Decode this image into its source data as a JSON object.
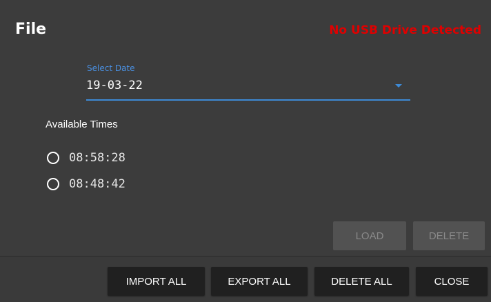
{
  "dialog": {
    "title": "File",
    "usb_status": "No USB Drive Detected",
    "usb_status_color": "#e00000"
  },
  "date_select": {
    "label": "Select Date",
    "value": "19-03-22",
    "icon": "caret-down-icon",
    "accent_color": "#3d8ad6"
  },
  "times": {
    "heading": "Available Times",
    "options": [
      {
        "label": "08:58:28",
        "selected": false
      },
      {
        "label": "08:48:42",
        "selected": false
      }
    ]
  },
  "actions": {
    "load_label": "LOAD",
    "delete_label": "DELETE"
  },
  "footer": {
    "import_all_label": "IMPORT ALL",
    "export_all_label": "EXPORT ALL",
    "delete_all_label": "DELETE ALL",
    "close_label": "CLOSE"
  }
}
